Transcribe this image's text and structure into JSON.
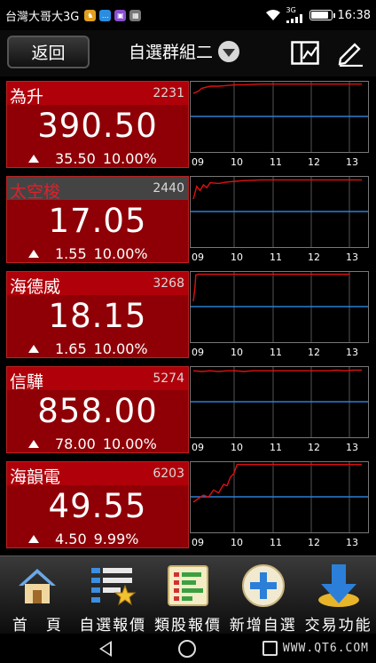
{
  "status_bar": {
    "carrier": "台灣大哥大3G",
    "network": "3G",
    "time": "16:38",
    "app_icons": [
      {
        "name": "app-notification-icon",
        "color": "#e0a020",
        "glyph": "♞"
      },
      {
        "name": "chat-icon",
        "color": "#2a8de0",
        "glyph": "…"
      },
      {
        "name": "gallery-icon",
        "color": "#8a4fd0",
        "glyph": "▣"
      },
      {
        "name": "image-icon",
        "color": "#777777",
        "glyph": "▦"
      }
    ]
  },
  "header": {
    "back_label": "返回",
    "title": "自選群組二"
  },
  "chart_axis_labels": [
    "09",
    "10",
    "11",
    "12",
    "13"
  ],
  "stocks": [
    {
      "name": "為升",
      "code": "2231",
      "price": "390.50",
      "change": "35.50",
      "percent": "10.00%",
      "selected": false,
      "chart_data": {
        "type": "line",
        "x": [
          0,
          0.03,
          0.05,
          0.1,
          0.15,
          0.2,
          0.25,
          0.3,
          0.4,
          0.5,
          0.6,
          0.7,
          0.8,
          0.9,
          1.0
        ],
        "y": [
          0.85,
          0.88,
          0.92,
          0.95,
          0.95,
          0.96,
          0.97,
          0.97,
          0.98,
          0.98,
          0.98,
          0.98,
          0.98,
          0.98,
          0.98
        ]
      }
    },
    {
      "name": "太空梭",
      "code": "2440",
      "price": "17.05",
      "change": "1.55",
      "percent": "10.00%",
      "selected": true,
      "chart_data": {
        "type": "line",
        "x": [
          0,
          0.02,
          0.04,
          0.06,
          0.08,
          0.1,
          0.15,
          0.2,
          0.25,
          0.3,
          0.4,
          0.5,
          0.6,
          0.7,
          0.8,
          0.9,
          1.0
        ],
        "y": [
          0.7,
          0.88,
          0.82,
          0.9,
          0.86,
          0.93,
          0.92,
          0.94,
          0.95,
          0.96,
          0.97,
          0.97,
          0.97,
          0.97,
          0.97,
          0.97,
          0.97
        ]
      }
    },
    {
      "name": "海德威",
      "code": "3268",
      "price": "18.15",
      "change": "1.65",
      "percent": "10.00%",
      "selected": false,
      "chart_data": {
        "type": "line",
        "x": [
          0,
          0.01,
          0.015,
          0.03,
          0.1,
          0.3,
          0.5,
          0.7,
          0.9,
          0.93
        ],
        "y": [
          0.6,
          0.8,
          0.97,
          0.98,
          0.98,
          0.98,
          0.98,
          0.98,
          0.98,
          0.98
        ]
      }
    },
    {
      "name": "信驊",
      "code": "5274",
      "price": "858.00",
      "change": "78.00",
      "percent": "10.00%",
      "selected": false,
      "chart_data": {
        "type": "line",
        "x": [
          0,
          0.05,
          0.1,
          0.15,
          0.2,
          0.25,
          0.3,
          0.35,
          0.4,
          0.45,
          0.5,
          0.55,
          0.6,
          0.65,
          0.7,
          0.75,
          0.8,
          0.85,
          0.9,
          0.95,
          1.0
        ],
        "y": [
          0.96,
          0.95,
          0.96,
          0.95,
          0.96,
          0.96,
          0.95,
          0.96,
          0.96,
          0.96,
          0.96,
          0.96,
          0.96,
          0.96,
          0.96,
          0.96,
          0.96,
          0.97,
          0.96,
          0.97,
          0.97
        ]
      }
    },
    {
      "name": "海韻電",
      "code": "6203",
      "price": "49.55",
      "change": "4.50",
      "percent": "9.99%",
      "selected": false,
      "chart_data": {
        "type": "line",
        "x": [
          0,
          0.03,
          0.06,
          0.09,
          0.12,
          0.15,
          0.18,
          0.2,
          0.22,
          0.24,
          0.26,
          0.3,
          0.4,
          0.5,
          0.6,
          0.7,
          0.8,
          0.9,
          1.0
        ],
        "y": [
          0.45,
          0.5,
          0.55,
          0.52,
          0.62,
          0.58,
          0.7,
          0.68,
          0.8,
          0.85,
          0.98,
          0.98,
          0.98,
          0.98,
          0.98,
          0.98,
          0.98,
          0.98,
          0.98
        ]
      }
    }
  ],
  "bottom_nav": [
    {
      "label": "首　頁",
      "icon": "home-icon"
    },
    {
      "label": "自選報價",
      "icon": "watchlist-icon"
    },
    {
      "label": "類股報價",
      "icon": "sector-quote-icon"
    },
    {
      "label": "新增自選",
      "icon": "add-watchlist-icon"
    },
    {
      "label": "交易功能",
      "icon": "trade-icon"
    }
  ],
  "watermark": "WWW.QT6.COM",
  "colors": {
    "quote_bg": "#8e0006",
    "chart_line": "#e01010",
    "chart_ref_line": "#2a7fd4",
    "grid": "#555555"
  }
}
